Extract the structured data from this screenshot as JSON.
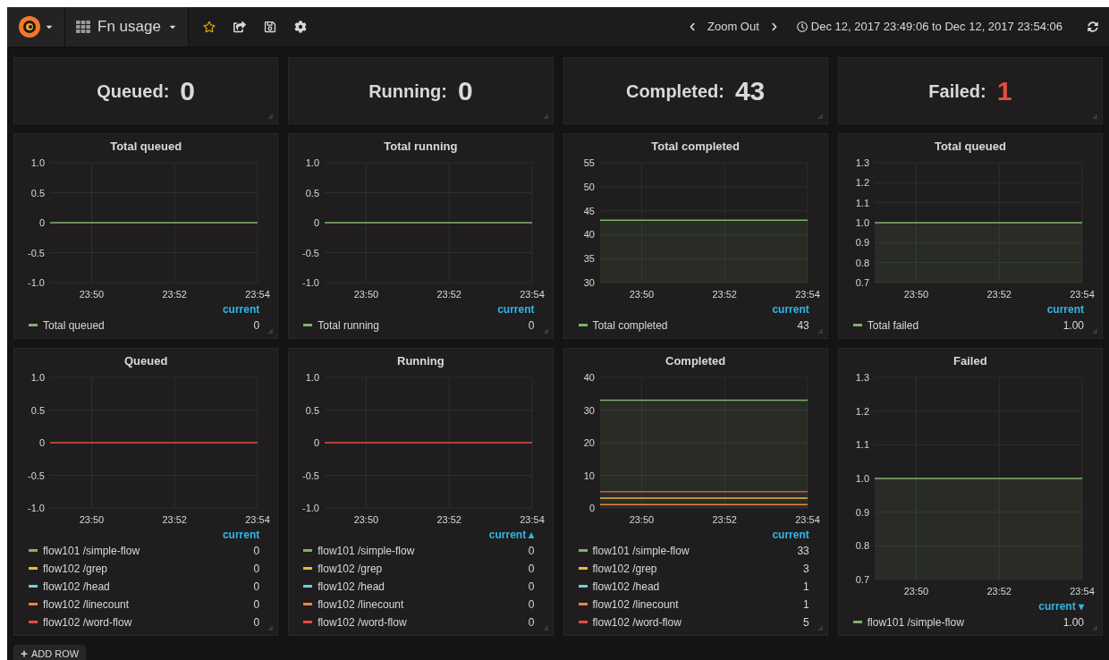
{
  "navbar": {
    "dashboard_title": "Fn usage",
    "zoom_label": "Zoom Out",
    "time_range": "Dec 12, 2017 23:49:06 to Dec 12, 2017 23:54:06"
  },
  "stats": [
    {
      "label": "Queued:",
      "value": "0",
      "color": "#d8d9da"
    },
    {
      "label": "Running:",
      "value": "0",
      "color": "#d8d9da"
    },
    {
      "label": "Completed:",
      "value": "43",
      "color": "#d8d9da"
    },
    {
      "label": "Failed:",
      "value": "1",
      "color": "#e24d42"
    }
  ],
  "graph_rows": [
    [
      {
        "title": "Total queued",
        "legend": {
          "header": "current",
          "values": [
            "0"
          ]
        },
        "chart_data": {
          "type": "line",
          "grid": true,
          "categories": [
            null,
            "23:50",
            null,
            "23:52",
            null,
            "23:54"
          ],
          "ylim": [
            -1,
            1
          ],
          "yticks": [
            {
              "value": -1,
              "label": "-1.0"
            },
            {
              "value": -0.5,
              "label": "-0.5"
            },
            0,
            {
              "value": 0.5,
              "label": "0.5"
            },
            {
              "value": 1,
              "label": "1.0"
            }
          ],
          "series": [
            {
              "name": "Total queued",
              "color": "#7eb26d",
              "values": [
                0,
                0,
                0,
                0,
                0,
                0
              ]
            }
          ]
        }
      },
      {
        "title": "Total running",
        "legend": {
          "header": "current",
          "values": [
            "0"
          ]
        },
        "chart_data": {
          "type": "line",
          "grid": true,
          "categories": [
            null,
            "23:50",
            null,
            "23:52",
            null,
            "23:54"
          ],
          "ylim": [
            -1,
            1
          ],
          "yticks": [
            {
              "value": -1,
              "label": "-1.0"
            },
            {
              "value": -0.5,
              "label": "-0.5"
            },
            0,
            {
              "value": 0.5,
              "label": "0.5"
            },
            {
              "value": 1,
              "label": "1.0"
            }
          ],
          "series": [
            {
              "name": "Total running",
              "color": "#7eb26d",
              "values": [
                0,
                0,
                0,
                0,
                0,
                0
              ]
            }
          ]
        }
      },
      {
        "title": "Total completed",
        "legend": {
          "header": "current",
          "values": [
            "43"
          ]
        },
        "chart_data": {
          "type": "area",
          "grid": true,
          "categories": [
            null,
            "23:50",
            null,
            "23:52",
            null,
            "23:54"
          ],
          "ylim": [
            30,
            55
          ],
          "yticks": [
            30,
            35,
            40,
            45,
            50,
            55
          ],
          "series": [
            {
              "name": "Total completed",
              "color": "#7eb26d",
              "values": [
                43,
                43,
                43,
                43,
                43,
                43
              ]
            }
          ]
        }
      },
      {
        "title": "Total queued",
        "legend": {
          "header": "current",
          "values": [
            "1.00"
          ]
        },
        "chart_data": {
          "type": "area",
          "grid": true,
          "categories": [
            null,
            "23:50",
            null,
            "23:52",
            null,
            "23:54"
          ],
          "ylim": [
            0.7,
            1.3
          ],
          "yticks": [
            0.7,
            0.8,
            0.9,
            {
              "value": 1,
              "label": "1.0"
            },
            1.1,
            1.2,
            1.3
          ],
          "series": [
            {
              "name": "Total failed",
              "color": "#7eb26d",
              "values": [
                1,
                1,
                1,
                1,
                1,
                1
              ]
            }
          ]
        }
      }
    ],
    [
      {
        "title": "Queued",
        "legend": {
          "header": "current",
          "values": [
            "0",
            "0",
            "0",
            "0",
            "0"
          ]
        },
        "chart_data": {
          "type": "line",
          "grid": true,
          "categories": [
            null,
            "23:50",
            null,
            "23:52",
            null,
            "23:54"
          ],
          "ylim": [
            -1,
            1
          ],
          "yticks": [
            {
              "value": -1,
              "label": "-1.0"
            },
            {
              "value": -0.5,
              "label": "-0.5"
            },
            0,
            {
              "value": 0.5,
              "label": "0.5"
            },
            {
              "value": 1,
              "label": "1.0"
            }
          ],
          "series": [
            {
              "name": "flow101 /simple-flow",
              "color": "#7eb26d",
              "values": [
                null,
                null,
                null,
                null,
                null,
                null
              ]
            },
            {
              "name": "flow102 /grep",
              "color": "#eab839",
              "values": [
                null,
                null,
                null,
                null,
                null,
                null
              ]
            },
            {
              "name": "flow102 /head",
              "color": "#6ed0e0",
              "values": [
                null,
                null,
                null,
                null,
                null,
                null
              ]
            },
            {
              "name": "flow102 /linecount",
              "color": "#ef843c",
              "values": [
                null,
                null,
                null,
                null,
                null,
                null
              ]
            },
            {
              "name": "flow102 /word-flow",
              "color": "#e24d42",
              "values": [
                0,
                0,
                0,
                0,
                0,
                0
              ]
            }
          ]
        }
      },
      {
        "title": "Running",
        "legend": {
          "header": "current ▴",
          "values": [
            "0",
            "0",
            "0",
            "0",
            "0"
          ]
        },
        "chart_data": {
          "type": "line",
          "grid": true,
          "categories": [
            null,
            "23:50",
            null,
            "23:52",
            null,
            "23:54"
          ],
          "ylim": [
            -1,
            1
          ],
          "yticks": [
            {
              "value": -1,
              "label": "-1.0"
            },
            {
              "value": -0.5,
              "label": "-0.5"
            },
            0,
            {
              "value": 0.5,
              "label": "0.5"
            },
            {
              "value": 1,
              "label": "1.0"
            }
          ],
          "series": [
            {
              "name": "flow101 /simple-flow",
              "color": "#7eb26d",
              "values": [
                null,
                null,
                null,
                null,
                null,
                null
              ]
            },
            {
              "name": "flow102 /grep",
              "color": "#eab839",
              "values": [
                null,
                null,
                null,
                null,
                null,
                null
              ]
            },
            {
              "name": "flow102 /head",
              "color": "#6ed0e0",
              "values": [
                null,
                null,
                null,
                null,
                null,
                null
              ]
            },
            {
              "name": "flow102 /linecount",
              "color": "#ef843c",
              "values": [
                null,
                null,
                null,
                null,
                null,
                null
              ]
            },
            {
              "name": "flow102 /word-flow",
              "color": "#e24d42",
              "values": [
                0,
                0,
                0,
                0,
                0,
                0
              ]
            }
          ]
        }
      },
      {
        "title": "Completed",
        "legend": {
          "header": "current",
          "values": [
            "33",
            "3",
            "1",
            "1",
            "5"
          ]
        },
        "chart_data": {
          "type": "line",
          "grid": true,
          "categories": [
            null,
            "23:50",
            null,
            "23:52",
            null,
            "23:54"
          ],
          "ylim": [
            0,
            40
          ],
          "yticks": [
            0,
            10,
            20,
            30,
            40
          ],
          "series": [
            {
              "name": "flow101 /simple-flow",
              "type": "area",
              "color": "#7eb26d",
              "values": [
                33,
                33,
                33,
                33,
                33,
                33
              ]
            },
            {
              "name": "flow102 /grep",
              "color": "#eab839",
              "values": [
                3,
                3,
                3,
                3,
                3,
                3
              ]
            },
            {
              "name": "flow102 /head",
              "color": "#6ed0e0",
              "values": [
                null,
                null,
                null,
                null,
                null,
                null
              ]
            },
            {
              "name": "flow102 /linecount",
              "color": "#ef843c",
              "values": [
                1,
                1,
                1,
                1,
                1,
                1
              ]
            },
            {
              "name": "flow102 /word-flow",
              "color": "#e24d42",
              "values": [
                5,
                5,
                5,
                5,
                5,
                5
              ]
            }
          ]
        }
      },
      {
        "title": "Failed",
        "legend": {
          "header": "current ▾",
          "values": [
            "1.00"
          ]
        },
        "chart_data": {
          "type": "area",
          "grid": true,
          "categories": [
            null,
            "23:50",
            null,
            "23:52",
            null,
            "23:54"
          ],
          "ylim": [
            0.7,
            1.3
          ],
          "yticks": [
            0.7,
            0.8,
            0.9,
            {
              "value": 1,
              "label": "1.0"
            },
            1.1,
            1.2,
            1.3
          ],
          "series": [
            {
              "name": "flow101 /simple-flow",
              "color": "#7eb26d",
              "values": [
                1,
                1,
                1,
                1,
                1,
                1
              ]
            }
          ]
        }
      }
    ]
  ],
  "add_row_button": "ADD ROW"
}
